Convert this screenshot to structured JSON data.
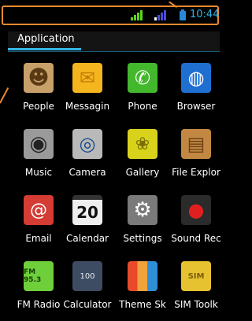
{
  "status_bar": {
    "time": "10:44"
  },
  "tab": {
    "label": "Application"
  },
  "apps": [
    {
      "label": "People",
      "icon": "people-icon",
      "color": "#c8a06a"
    },
    {
      "label": "Messagin",
      "icon": "messaging-icon",
      "color": "#f5b51e"
    },
    {
      "label": "Phone",
      "icon": "phone-icon",
      "color": "#43b82d"
    },
    {
      "label": "Browser",
      "icon": "browser-icon",
      "color": "#1f6fd1"
    },
    {
      "label": "Music",
      "icon": "music-icon",
      "color": "#9a9a9a"
    },
    {
      "label": "Camera",
      "icon": "camera-icon",
      "color": "#b9b9b9"
    },
    {
      "label": "Gallery",
      "icon": "gallery-icon",
      "color": "#d8d21a"
    },
    {
      "label": "File Explor",
      "icon": "file-explorer-icon",
      "color": "#c28743"
    },
    {
      "label": "Email",
      "icon": "email-icon",
      "color": "#d43c34"
    },
    {
      "label": "Calendar",
      "icon": "calendar-icon",
      "color": "#eeeeee",
      "day": "20"
    },
    {
      "label": "Settings",
      "icon": "settings-icon",
      "color": "#7a7a7a"
    },
    {
      "label": "Sound Rec",
      "icon": "sound-recorder-icon",
      "color": "#2b2b2b"
    },
    {
      "label": "FM Radio",
      "icon": "fm-radio-icon",
      "color": "#6fcf3a",
      "text": "FM 95.3"
    },
    {
      "label": "Calculator",
      "icon": "calculator-icon",
      "color": "#3d4c63",
      "text": "100"
    },
    {
      "label": "Theme Sk",
      "icon": "theme-skin-icon",
      "color": "#f0a23b"
    },
    {
      "label": "SIM Toolk",
      "icon": "sim-toolkit-icon",
      "color": "#e7c230",
      "text": "SIM"
    }
  ]
}
